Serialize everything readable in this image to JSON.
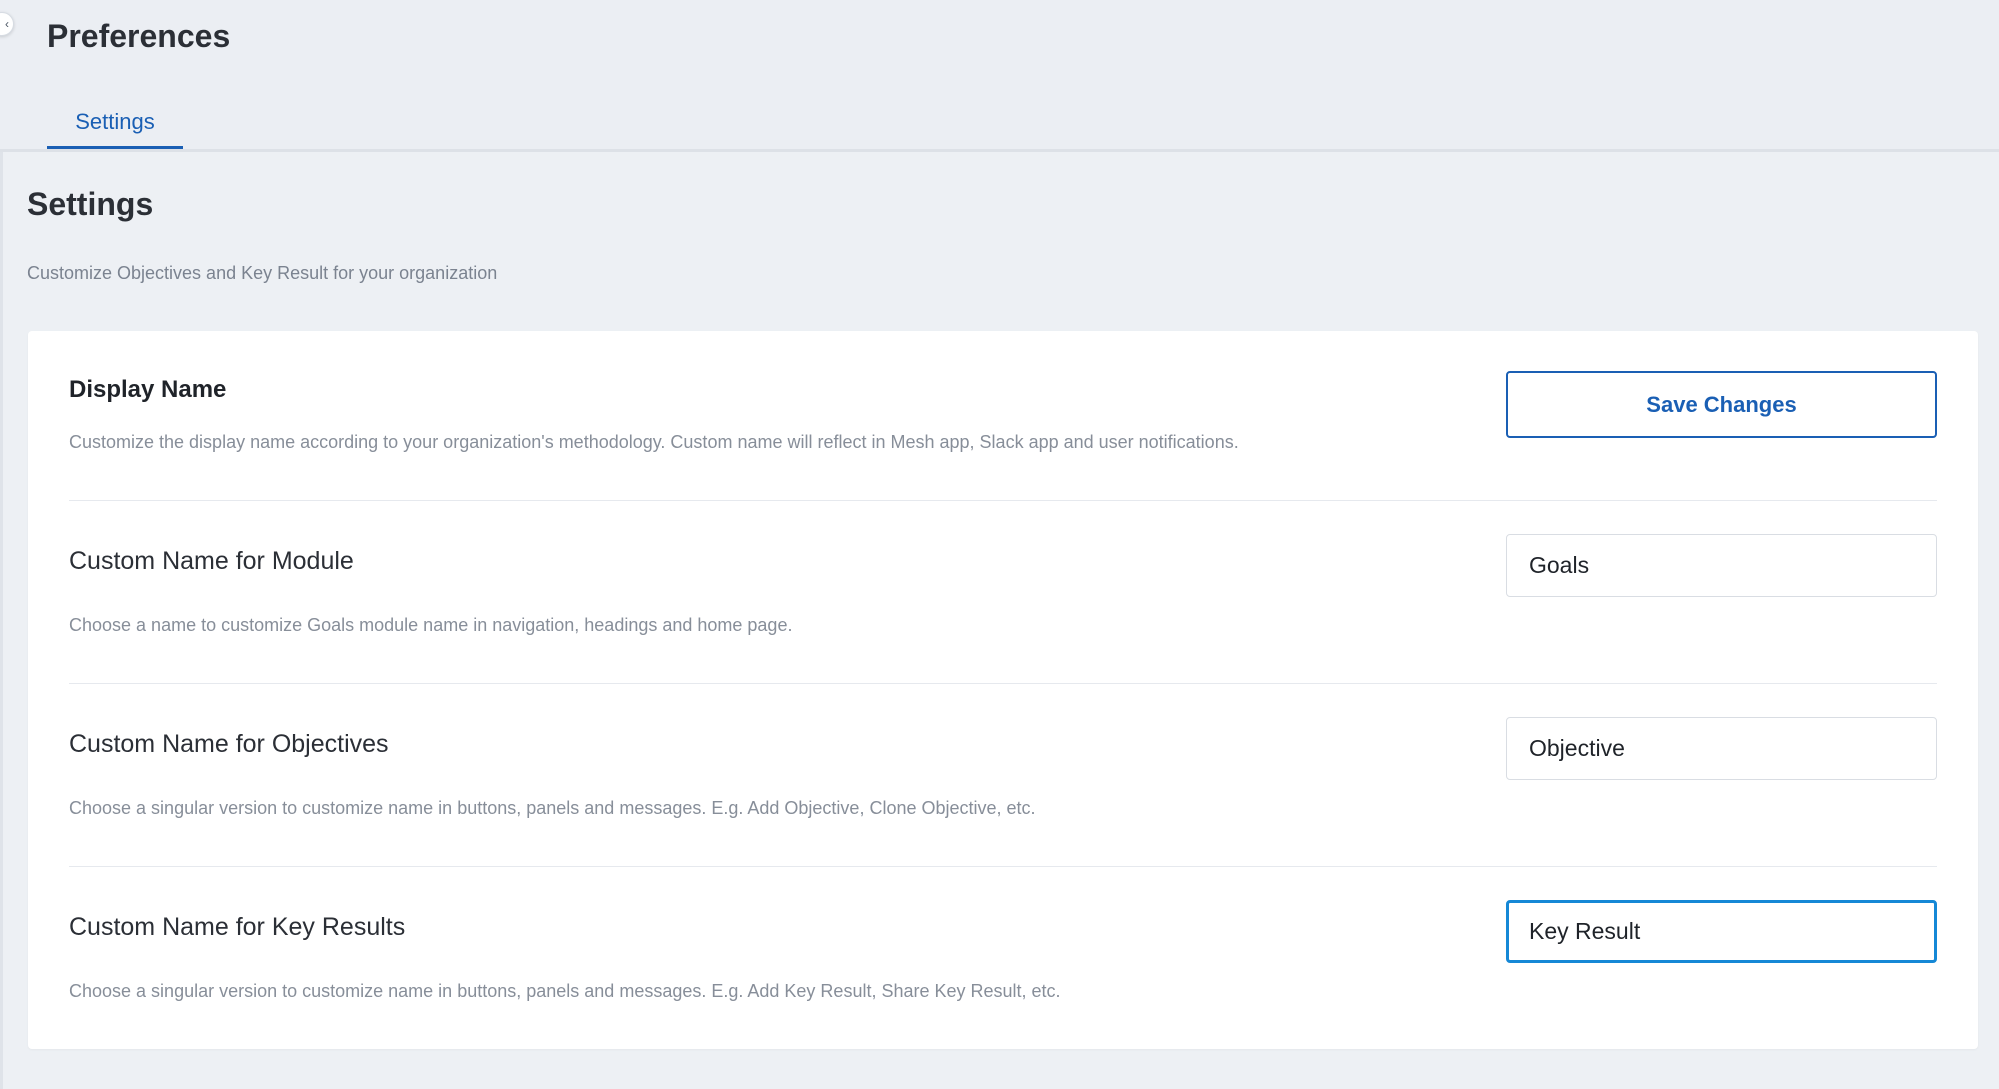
{
  "header": {
    "title": "Preferences",
    "tabs": [
      {
        "label": "Settings",
        "active": true
      }
    ]
  },
  "settings": {
    "title": "Settings",
    "subtitle": "Customize Objectives and Key Result for your organization"
  },
  "card": {
    "display_name": {
      "title": "Display Name",
      "description": "Customize the display name according to your organization's methodology. Custom name will reflect in Mesh app, Slack app and user notifications.",
      "save_label": "Save Changes"
    },
    "module": {
      "title": "Custom Name for Module",
      "description": "Choose a name to customize Goals module name in navigation, headings and home page.",
      "value": "Goals"
    },
    "objectives": {
      "title": "Custom Name for Objectives",
      "description": "Choose a singular version to customize name in buttons, panels and messages. E.g. Add Objective, Clone Objective, etc.",
      "value": "Objective"
    },
    "key_results": {
      "title": "Custom Name for Key Results",
      "description": "Choose a singular version to customize name in buttons, panels and messages. E.g. Add Key Result, Share Key Result, etc.",
      "value": "Key Result"
    }
  },
  "colors": {
    "accent": "#1a5fb4",
    "focus": "#1588d6",
    "background": "#edf0f4"
  },
  "icons": {
    "collapse": "chevron-left-icon"
  }
}
